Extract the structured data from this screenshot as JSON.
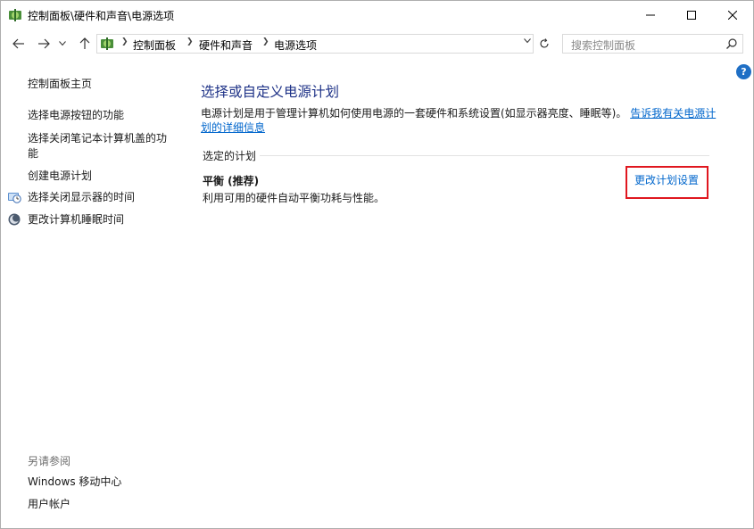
{
  "window": {
    "title": "控制面板\\硬件和声音\\电源选项"
  },
  "nav": {
    "back_icon": "arrow-left-icon",
    "forward_icon": "arrow-right-icon",
    "recent_icon": "chevron-down-icon",
    "up_icon": "arrow-up-icon"
  },
  "address": {
    "crumbs": [
      "控制面板",
      "硬件和声音",
      "电源选项"
    ]
  },
  "search": {
    "placeholder": "搜索控制面板"
  },
  "help": {
    "label": "?"
  },
  "sidebar": {
    "items": [
      {
        "label": "控制面板主页"
      },
      {
        "label": "选择电源按钮的功能"
      },
      {
        "label_line1": "选择关闭笔记本计算机盖的功",
        "label_line2": "能"
      },
      {
        "label": "创建电源计划"
      },
      {
        "label": "选择关闭显示器的时间",
        "icon": "clock-monitor-icon"
      },
      {
        "label": "更改计算机睡眠时间",
        "icon": "moon-icon"
      }
    ],
    "see_also": {
      "heading": "另请参阅",
      "items": [
        {
          "label": "Windows 移动中心"
        },
        {
          "label": "用户帐户"
        }
      ]
    }
  },
  "main": {
    "title": "选择或自定义电源计划",
    "description": "电源计划是用于管理计算机如何使用电源的一套硬件和系统设置(如显示器亮度、睡眠等)。",
    "more_info_link_line1": "告诉我有关电源计",
    "more_info_link_line2": "划的详细信息",
    "section_label": "选定的计划",
    "plan": {
      "name": "平衡 (推荐)",
      "description": "利用可用的硬件自动平衡功耗与性能。",
      "change_link": "更改计划设置"
    }
  },
  "colors": {
    "title_blue": "#1e3287",
    "link_blue": "#0066cc",
    "highlight_red": "#e0171f"
  }
}
